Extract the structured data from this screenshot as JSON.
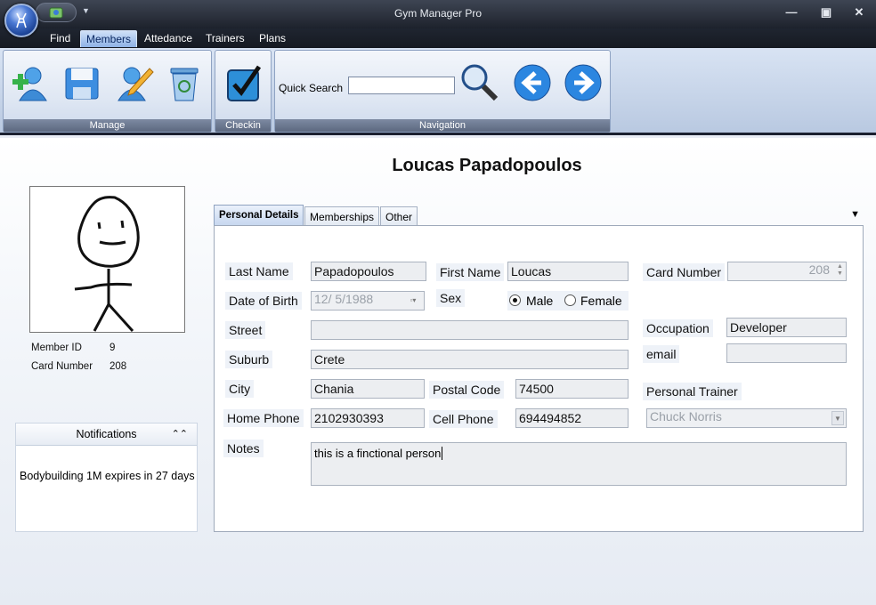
{
  "window": {
    "title": "Gym Manager Pro"
  },
  "menu": {
    "items": [
      "Find",
      "Members",
      "Attedance",
      "Trainers",
      "Plans"
    ]
  },
  "ribbon": {
    "groups": {
      "manage": "Manage",
      "checkin": "Checkin",
      "navigation": "Navigation"
    },
    "quick_search_label": "Quick Search",
    "quick_search_value": ""
  },
  "member": {
    "full_name": "Loucas Papadopoulos",
    "member_id_label": "Member ID",
    "member_id": "9",
    "card_number_label": "Card Number",
    "card_number": "208"
  },
  "notifications": {
    "title": "Notifications",
    "items": [
      "Bodybuilding 1M expires in 27 days"
    ]
  },
  "tabs": [
    "Personal Details",
    "Memberships",
    "Other"
  ],
  "form": {
    "last_name": {
      "label": "Last Name",
      "value": "Papadopoulos"
    },
    "first_name": {
      "label": "First Name",
      "value": "Loucas"
    },
    "card_number": {
      "label": "Card Number",
      "value": "208"
    },
    "date_of_birth": {
      "label": "Date of Birth",
      "value": "12/  5/1988"
    },
    "sex": {
      "label": "Sex",
      "options": [
        "Male",
        "Female"
      ],
      "selected": "Male"
    },
    "street": {
      "label": "Street",
      "value": ""
    },
    "occupation": {
      "label": "Occupation",
      "value": "Developer"
    },
    "suburb": {
      "label": "Suburb",
      "value": "Crete"
    },
    "email": {
      "label": "email",
      "value": ""
    },
    "city": {
      "label": "City",
      "value": "Chania"
    },
    "postal_code": {
      "label": "Postal Code",
      "value": "74500"
    },
    "personal_trainer": {
      "label": "Personal Trainer",
      "value": "Chuck Norris"
    },
    "home_phone": {
      "label": "Home Phone",
      "value": "2102930393"
    },
    "cell_phone": {
      "label": "Cell Phone",
      "value": "694494852"
    },
    "notes": {
      "label": "Notes",
      "value": "this is a finctional person"
    }
  },
  "colors": {
    "ribbon_label_bg": "#5c687f",
    "active_tab": "#c4d5ee",
    "titlebar": "#1d222c"
  },
  "icons": [
    "app-orb-icon",
    "add-member-icon",
    "save-icon",
    "edit-icon",
    "delete-icon",
    "checkin-icon",
    "search-icon",
    "back-arrow-icon",
    "forward-arrow-icon"
  ]
}
